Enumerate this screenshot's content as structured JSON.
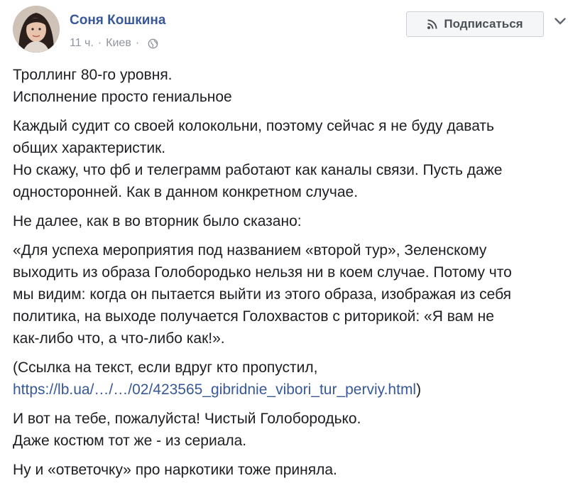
{
  "post": {
    "author": "Соня Кошкина",
    "time": "11 ч.",
    "separator": "·",
    "location": "Киев",
    "subscribe_label": "Подписаться",
    "icons": {
      "subscribe": "rss-icon",
      "privacy": "globe-icon",
      "more": "chevron-down-icon"
    },
    "colors": {
      "link": "#385898",
      "meta": "#90949c",
      "text": "#1c1e21"
    },
    "body": {
      "p1": [
        "Троллинг 80-го уровня.",
        "Исполнение просто гениальное"
      ],
      "p2": [
        "Каждый судит со своей колокольни, поэтому сейчас я не буду давать",
        "общих характеристик.",
        "Но скажу, что фб и телеграмм работают как каналы связи. Пусть даже",
        "односторонней. Как в данном конкретном случае."
      ],
      "p3": "Не далее, как в во вторник было сказано:",
      "p4": [
        "«Для успеха мероприятия под названием «второй тур», Зеленскому",
        "выходить из образа Голобородько нельзя ни в коем случае. Потому что",
        "мы видим: когда он пытается выйти из этого образа, изображая из себя",
        "политика, на выходе получается Голохвастов с риторикой: «Я вам не",
        "как-либо что, а что-либо как!»."
      ],
      "p5_line1": "(Ссылка на текст, если вдруг кто пропустил,",
      "p5_link": "https://lb.ua/…/…/02/423565_gibridnie_vibori_tur_perviy.html",
      "p5_close": ")",
      "p6": [
        "И вот на тебе, пожалуйста! Чистый Голобородько.",
        "Даже костюм тот же - из сериала."
      ],
      "p7": "Ну и «ответочку» про наркотики тоже приняла."
    }
  }
}
